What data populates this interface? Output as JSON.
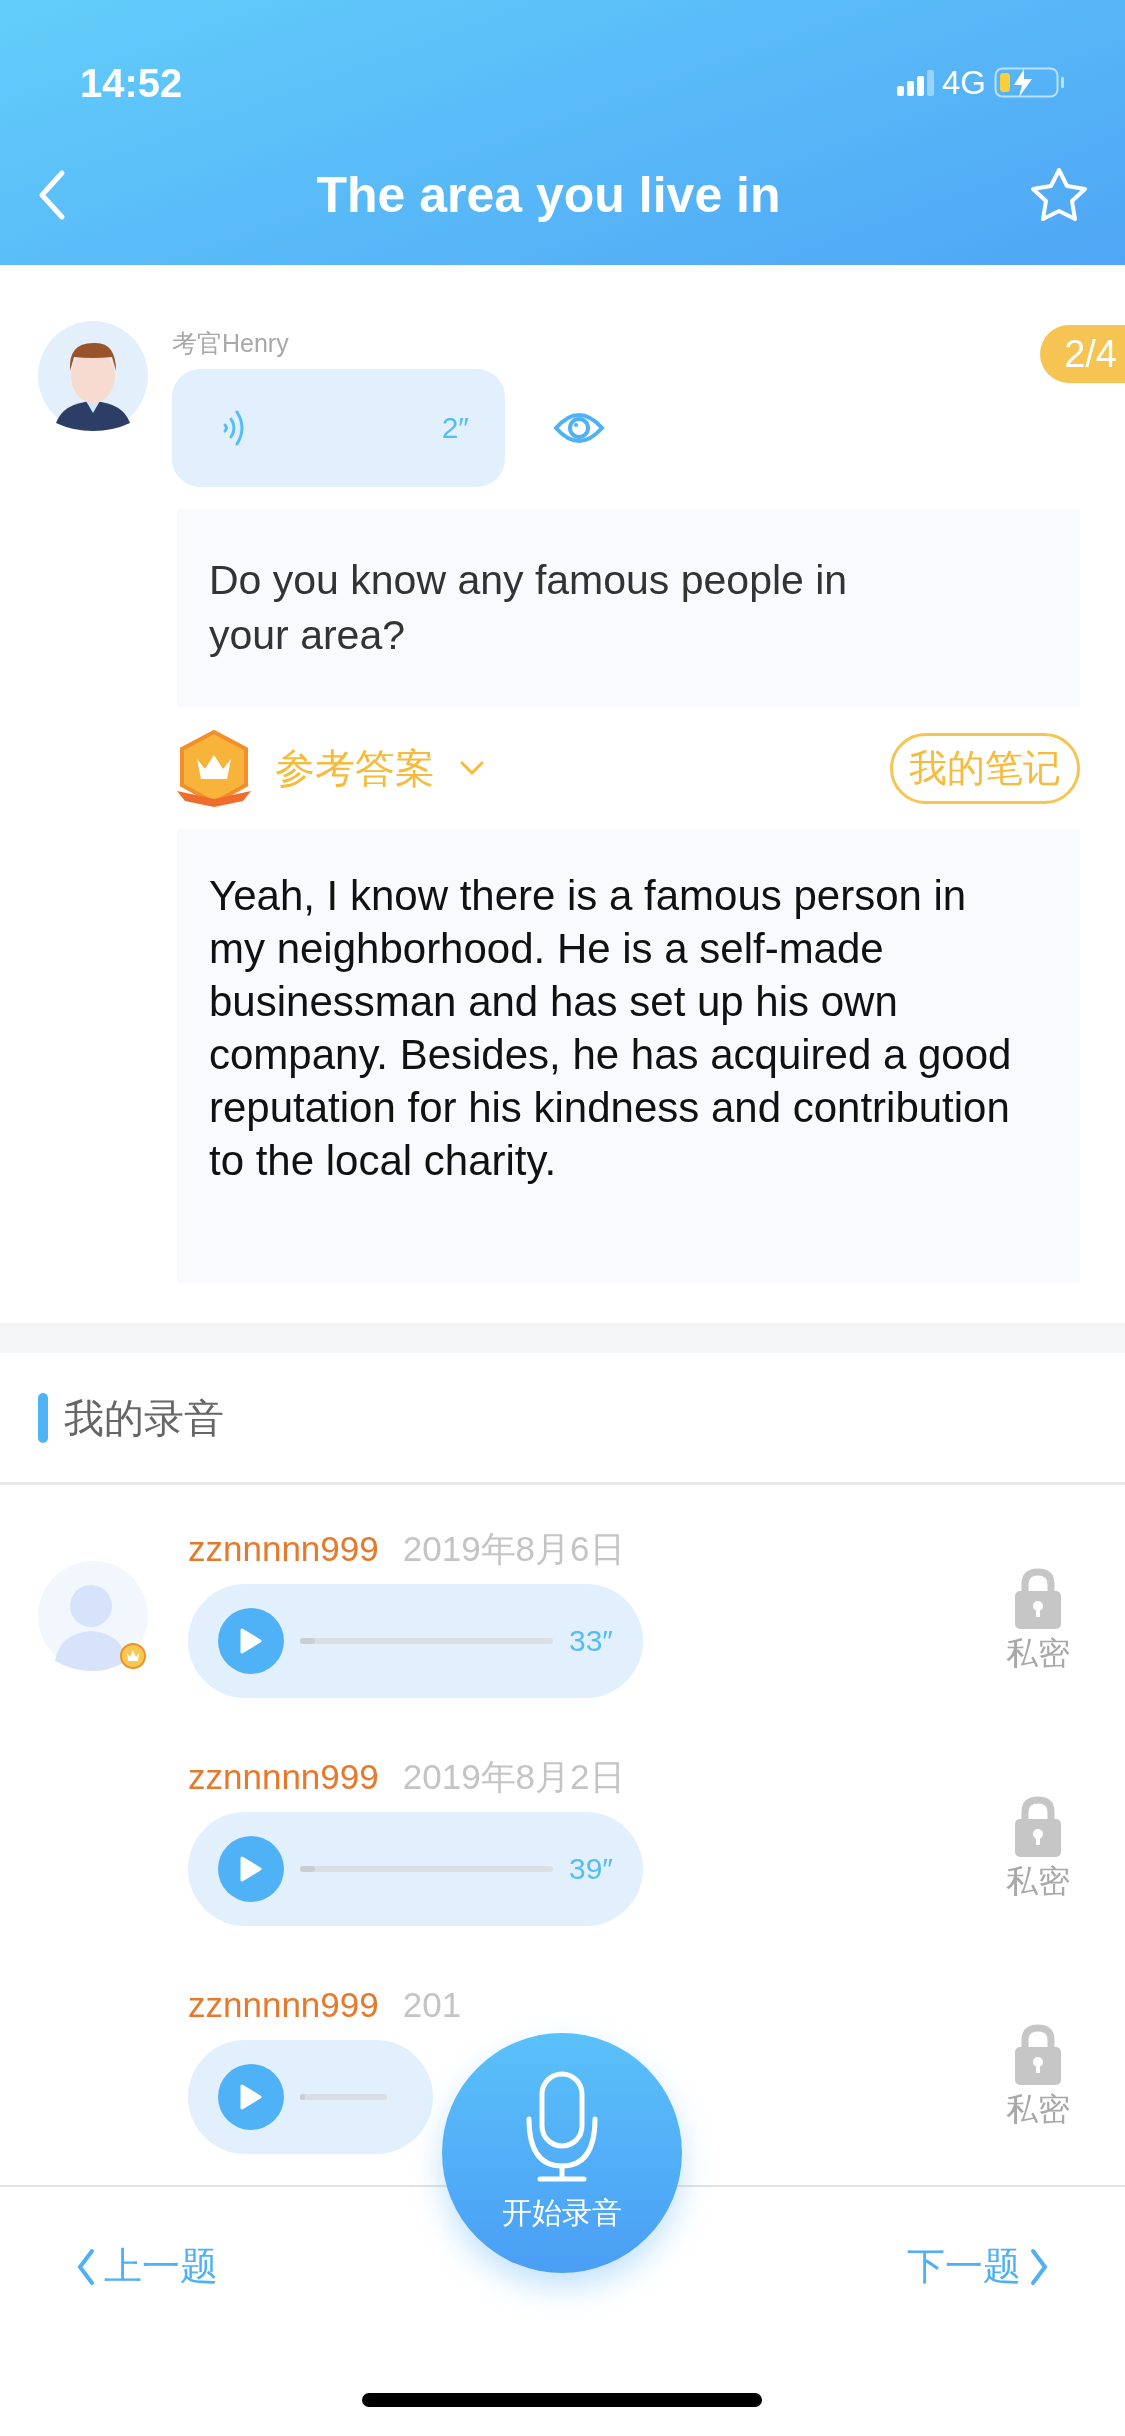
{
  "status_bar": {
    "time": "14:52",
    "network": "4G"
  },
  "header": {
    "title": "The area you live in"
  },
  "examiner": {
    "name": "考官Henry",
    "audio_duration": "2″",
    "progress": "2/4"
  },
  "question": "Do you know any famous people in your area?",
  "answer_header": {
    "label": "参考答案",
    "notes_button": "我的笔记"
  },
  "answer": "Yeah, I know there is a famous person in my neighborhood. He is a self-made businessman and has set up his own company. Besides, he has acquired a good reputation for his kindness and contribution to the local charity.",
  "recordings_section": {
    "title": "我的录音"
  },
  "recordings": [
    {
      "user": "zznnnnn999",
      "date": "2019年8月6日",
      "duration": "33″",
      "level": 0.06,
      "privacy": "私密",
      "avatar": true
    },
    {
      "user": "zznnnnn999",
      "date": "2019年8月2日",
      "duration": "39″",
      "level": 0.06,
      "privacy": "私密",
      "avatar": false
    },
    {
      "user": "zznnnnn999",
      "date": "201",
      "level": 0.06,
      "privacy": "私密",
      "avatar": false
    }
  ],
  "bottom_bar": {
    "prev": "上一题",
    "record": "开始录音",
    "next": "下一题"
  }
}
